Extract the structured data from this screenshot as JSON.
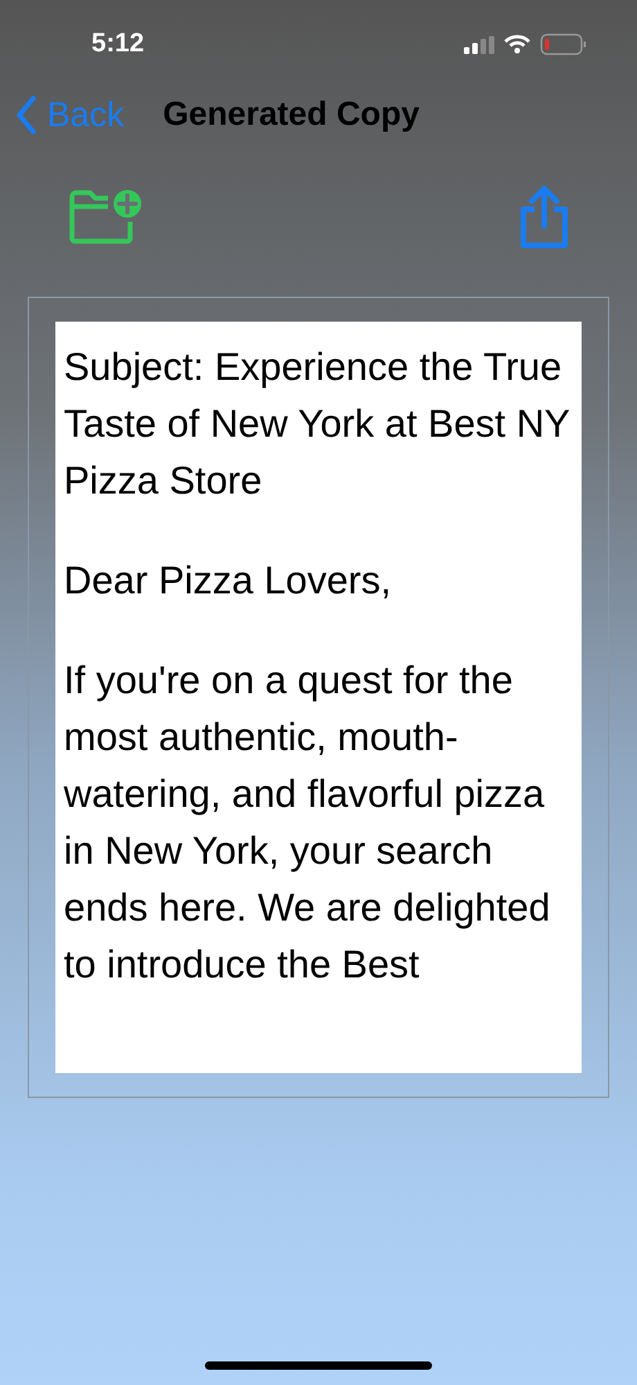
{
  "status_bar": {
    "time": "5:12"
  },
  "nav": {
    "back": "Back",
    "title": "Generated Copy"
  },
  "document": {
    "paragraphs": [
      "Subject: Experience the True Taste of New York at Best NY Pizza Store",
      "Dear Pizza Lovers,",
      "If you're on a quest for the most authentic, mouth-watering, and flavorful pizza in New York, your search ends here. We are delighted to introduce the Best"
    ]
  }
}
